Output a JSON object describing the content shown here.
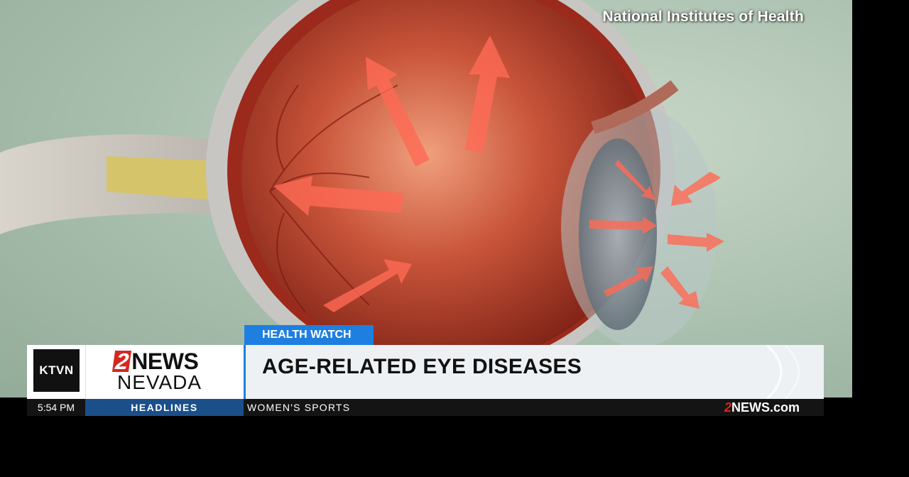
{
  "video": {
    "credit": "National Institutes of Health",
    "illustration": "eye-cross-section-icon"
  },
  "lower_third": {
    "segment_tag": "HEALTH WATCH",
    "headline": "AGE-RELATED EYE DISEASES",
    "station_call": "KTVN",
    "brand_number": "2",
    "brand_word": "NEWS",
    "brand_region": "NEVADA"
  },
  "ticker": {
    "time": "5:54 PM",
    "section": "HEADLINES",
    "crawl": "WOMEN'S SPORTS",
    "site_number": "2",
    "site_word": "NEWS.com"
  },
  "colors": {
    "accent_blue": "#1e7fe0",
    "brand_red": "#d7261e",
    "section_blue": "#1b4f8a"
  }
}
